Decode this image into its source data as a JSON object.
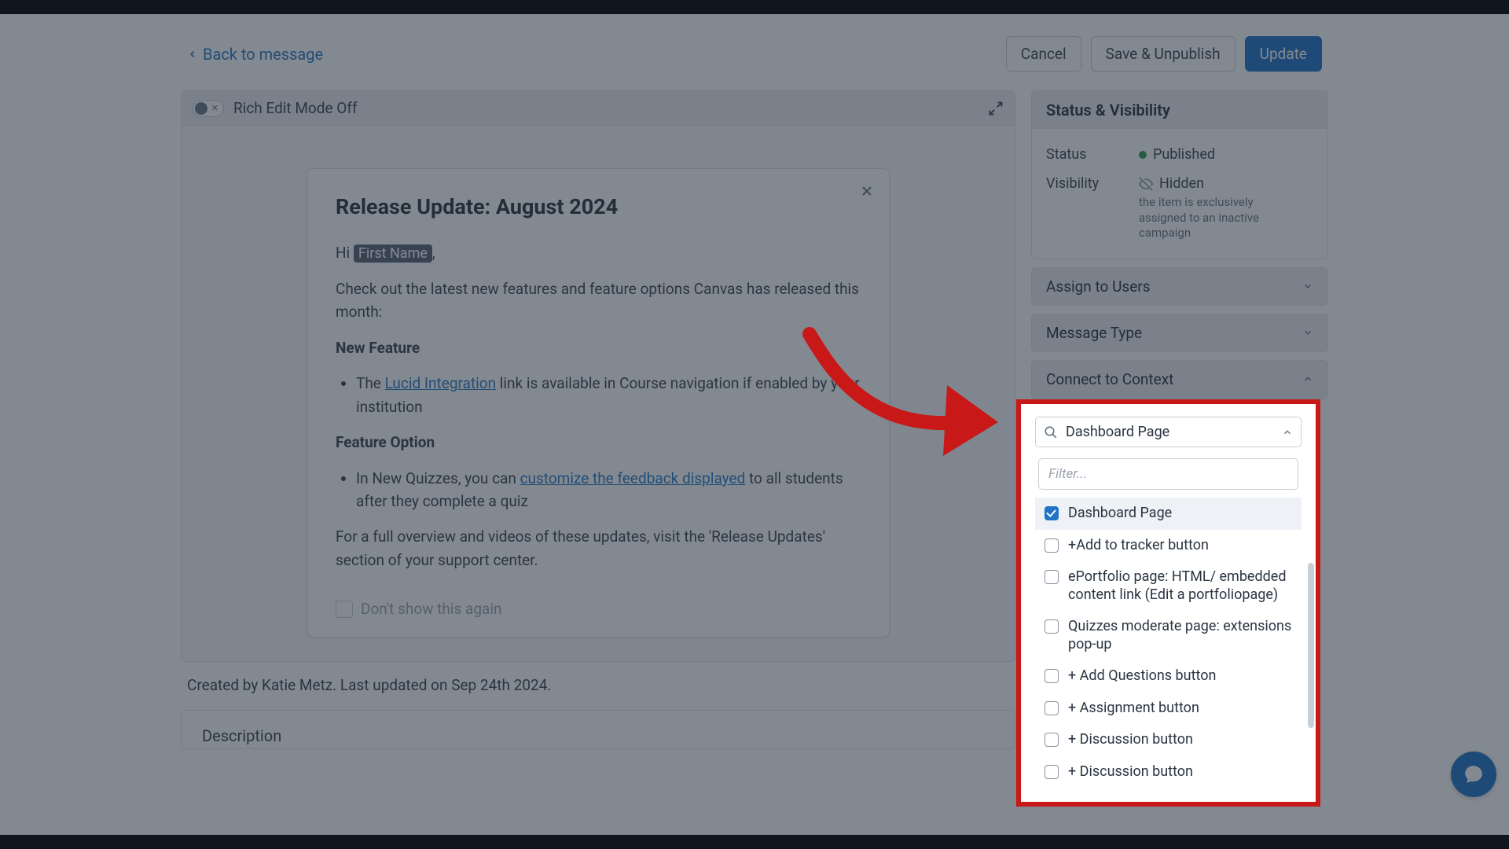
{
  "top": {
    "back": "Back to message",
    "cancel": "Cancel",
    "save_unpub": "Save & Unpublish",
    "update": "Update"
  },
  "editor": {
    "toggle_label": "Rich Edit Mode Off",
    "title": "Release Update: August 2024",
    "greeting_prefix": "Hi ",
    "greeting_token": "First Name",
    "greeting_suffix": ",",
    "intro": "Check out the latest new features and feature options Canvas has released this month:",
    "h_new_feature": "New Feature",
    "li1_pre": "The ",
    "li1_link": "Lucid Integration",
    "li1_post": " link is available in Course navigation if enabled by your institution",
    "h_feature_option": "Feature Option",
    "li2_pre": "In New Quizzes, you can ",
    "li2_link": "customize the feedback displayed",
    "li2_post": " to all students after they complete a quiz",
    "closing": "For a full overview and videos of these updates, visit the 'Release Updates' section of your support center.",
    "dont_show": "Don't show this again"
  },
  "meta": "Created by Katie Metz. Last updated on Sep 24th 2024.",
  "desc_label": "Description",
  "side": {
    "panel_title": "Status & Visibility",
    "status_label": "Status",
    "status_value": "Published",
    "visibility_label": "Visibility",
    "visibility_value": "Hidden",
    "visibility_hint": "the item is exclusively assigned to an inactive campaign",
    "assign": "Assign to Users",
    "msg_type": "Message Type",
    "connect": "Connect to Context"
  },
  "context": {
    "selected": "Dashboard Page",
    "filter_placeholder": "Filter...",
    "options": [
      {
        "label": "Dashboard Page",
        "checked": true
      },
      {
        "label": "+Add to tracker button",
        "checked": false
      },
      {
        "label": "ePortfolio page: HTML/ embedded content link (Edit a portfoliopage)",
        "checked": false
      },
      {
        "label": "Quizzes moderate page: extensions pop-up",
        "checked": false
      },
      {
        "label": "+ Add Questions button",
        "checked": false
      },
      {
        "label": "+ Assignment button",
        "checked": false
      },
      {
        "label": "+ Discussion button",
        "checked": false
      },
      {
        "label": "+ Discussion button",
        "checked": false
      }
    ]
  }
}
